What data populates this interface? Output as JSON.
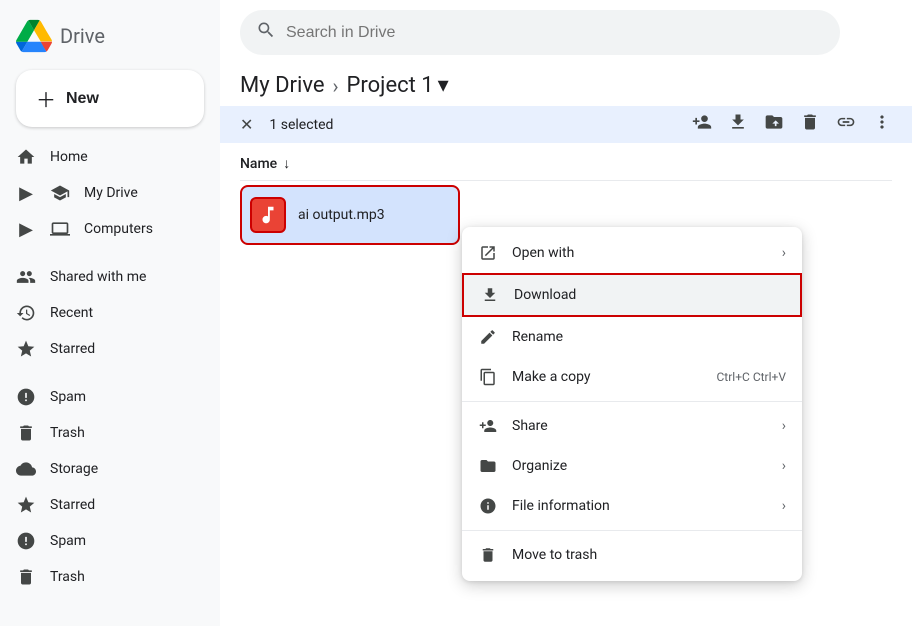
{
  "logo": {
    "text": "Drive"
  },
  "new_button": {
    "label": "New"
  },
  "search": {
    "placeholder": "Search in Drive"
  },
  "sidebar": {
    "items": [
      {
        "id": "home",
        "label": "Home",
        "icon": "🏠"
      },
      {
        "id": "my-drive",
        "label": "My Drive",
        "icon": "📁",
        "expandable": true
      },
      {
        "id": "computers",
        "label": "Computers",
        "icon": "🖥️",
        "expandable": true
      },
      {
        "id": "shared",
        "label": "Shared with me",
        "icon": "👤"
      },
      {
        "id": "recent",
        "label": "Recent",
        "icon": "🕐"
      },
      {
        "id": "starred",
        "label": "Starred",
        "icon": "⭐"
      },
      {
        "id": "spam",
        "label": "Spam",
        "icon": "🚫"
      },
      {
        "id": "trash",
        "label": "Trash",
        "icon": "🗑️"
      },
      {
        "id": "storage",
        "label": "Storage",
        "icon": "☁️"
      },
      {
        "id": "starred2",
        "label": "Starred",
        "icon": "⭐"
      },
      {
        "id": "spam2",
        "label": "Spam",
        "icon": "🚫"
      },
      {
        "id": "trash2",
        "label": "Trash",
        "icon": "🗑️"
      }
    ]
  },
  "breadcrumb": {
    "root": "My Drive",
    "separator": "›",
    "current": "Project 1",
    "dropdown_icon": "▾"
  },
  "action_bar": {
    "selected_label": "1 selected",
    "close_icon": "✕",
    "icons": [
      "person_add",
      "download",
      "upload_folder",
      "delete",
      "link",
      "more_vert"
    ]
  },
  "file_list": {
    "sort_label": "Name",
    "sort_icon": "↓",
    "file": {
      "name": "ai output.mp3",
      "type": "mp3"
    }
  },
  "context_menu": {
    "items": [
      {
        "id": "open-with",
        "label": "Open with",
        "has_arrow": true
      },
      {
        "id": "download",
        "label": "Download",
        "highlighted": true
      },
      {
        "id": "rename",
        "label": "Rename"
      },
      {
        "id": "make-copy",
        "label": "Make a copy",
        "shortcut": "Ctrl+C Ctrl+V"
      },
      {
        "id": "share",
        "label": "Share",
        "has_arrow": true
      },
      {
        "id": "organize",
        "label": "Organize",
        "has_arrow": true
      },
      {
        "id": "file-info",
        "label": "File information",
        "has_arrow": true
      },
      {
        "id": "move-trash",
        "label": "Move to trash"
      }
    ]
  }
}
